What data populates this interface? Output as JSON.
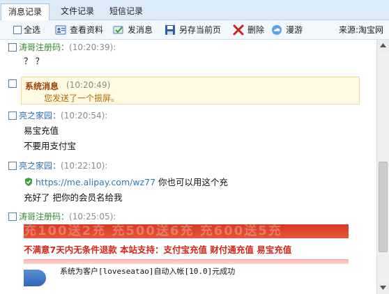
{
  "tabs": [
    {
      "label": "消息记录",
      "active": true
    },
    {
      "label": "文件记录",
      "active": false
    },
    {
      "label": "短信记录",
      "active": false
    }
  ],
  "toolbar": {
    "select_all": "全选",
    "view_profile": "查看资料",
    "send_message": "发消息",
    "save_page": "另存当前页",
    "delete": "删除",
    "roam": "漫游",
    "source": "来源:淘宝网"
  },
  "messages": [
    {
      "sender": "涛哥注册码：",
      "time": "(10:20:39):",
      "lines": [
        "？ ？"
      ]
    },
    {
      "system_title": "系统消息",
      "time": "(10:20:49)",
      "body": "您发送了一个振屏。"
    },
    {
      "sender": "亮之家园：",
      "time": "(10:20:54):",
      "lines": [
        "易宝充值",
        "不要用支付宝"
      ]
    },
    {
      "sender": "亮之家园：",
      "time": "(10:22:10):",
      "link": "https://me.alipay.com/wz77",
      "link_suffix": " 你也可以用这个充",
      "lines": [
        "充好了 把你的会员名给我"
      ]
    },
    {
      "sender": "涛哥注册码：",
      "time": "(10:25:05):"
    }
  ],
  "banner": {
    "top_text": "充100送2充 充500送6充 充600送5充",
    "mid_text": "不满意7天内无条件退款  本站支持：支付宝充值    财付通充值    易宝充值"
  },
  "notice": {
    "text": "系统为客户[loveseatao]自动入帐[10.0]元成功"
  },
  "colors": {
    "tab_bar": "#dcebf8",
    "sender_green": "#2e8b2e",
    "sender_blue": "#2f6fb3",
    "system_box": "#fffbe4",
    "banner_red": "#d6241a",
    "link": "#2f7ab6"
  }
}
